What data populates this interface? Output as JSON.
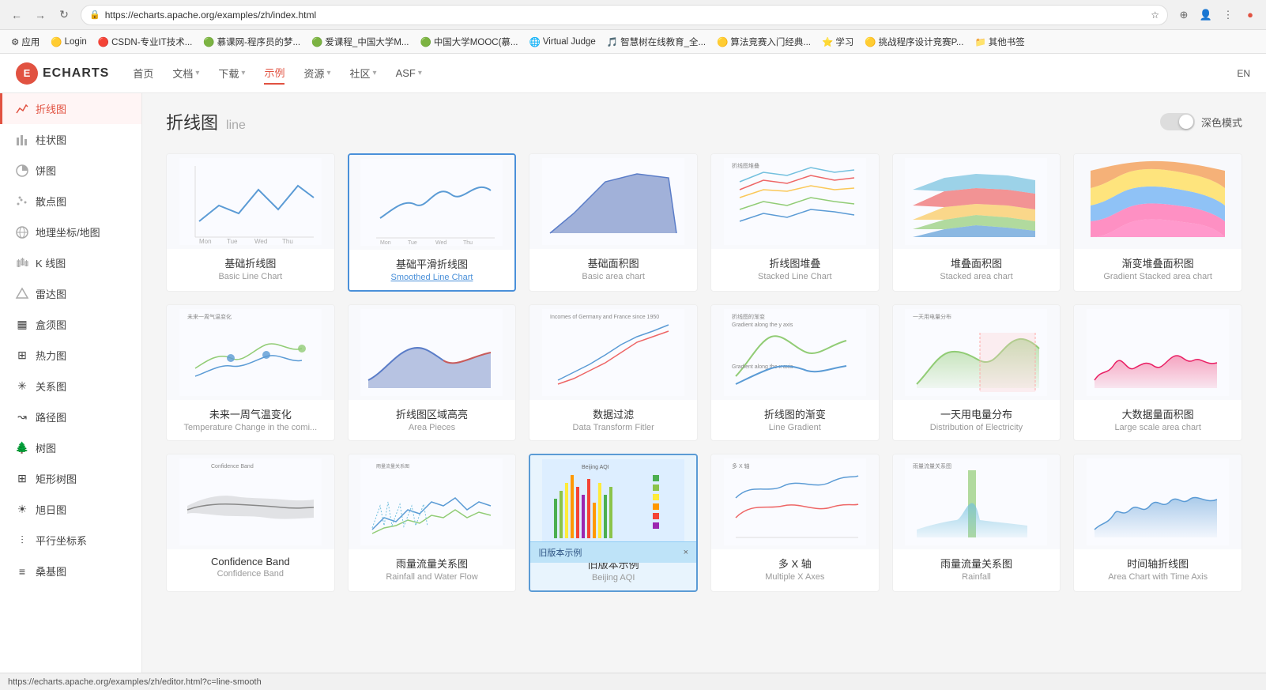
{
  "browser": {
    "url": "https://echarts.apache.org/examples/zh/index.html",
    "bookmarks": [
      {
        "label": "应用",
        "icon": "⚙"
      },
      {
        "label": "Login",
        "icon": "🟡"
      },
      {
        "label": "CSDN-专业IT技术...",
        "icon": "🔴"
      },
      {
        "label": "慕课网-程序员的梦...",
        "icon": "🟢"
      },
      {
        "label": "爱课程_中国大学M...",
        "icon": "🟢"
      },
      {
        "label": "中国大学MOOC(慕...",
        "icon": "🟢"
      },
      {
        "label": "Virtual Judge",
        "icon": "🌐"
      },
      {
        "label": "智慧树在线教育_全...",
        "icon": "🎵"
      },
      {
        "label": "算法竞赛入门经典...",
        "icon": "🟡"
      },
      {
        "label": "学习",
        "icon": "⭐"
      },
      {
        "label": "挑战程序设计竞赛P...",
        "icon": "🟡"
      },
      {
        "label": "其他书签",
        "icon": "📁"
      }
    ]
  },
  "header": {
    "logo": "ECHARTS",
    "nav": [
      {
        "label": "首页",
        "active": false
      },
      {
        "label": "文档",
        "active": false,
        "dropdown": true
      },
      {
        "label": "下载",
        "active": false,
        "dropdown": true
      },
      {
        "label": "示例",
        "active": true
      },
      {
        "label": "资源",
        "active": false,
        "dropdown": true
      },
      {
        "label": "社区",
        "active": false,
        "dropdown": true
      },
      {
        "label": "ASF",
        "active": false,
        "dropdown": true
      }
    ],
    "lang": "EN"
  },
  "sidebar": {
    "items": [
      {
        "label": "折线图",
        "icon": "📈",
        "active": true
      },
      {
        "label": "柱状图",
        "icon": "📊"
      },
      {
        "label": "饼图",
        "icon": "🥧"
      },
      {
        "label": "散点图",
        "icon": "📉"
      },
      {
        "label": "地理坐标/地图",
        "icon": "🗺"
      },
      {
        "label": "K 线图",
        "icon": "📊"
      },
      {
        "label": "雷达图",
        "icon": "⬡"
      },
      {
        "label": "盒须图",
        "icon": "▦"
      },
      {
        "label": "热力图",
        "icon": "⊞"
      },
      {
        "label": "关系图",
        "icon": "✳"
      },
      {
        "label": "路径图",
        "icon": "↝"
      },
      {
        "label": "树图",
        "icon": "🌲"
      },
      {
        "label": "矩形树图",
        "icon": "⊞"
      },
      {
        "label": "旭日图",
        "icon": "☀"
      },
      {
        "label": "平行坐标系",
        "icon": "⫶"
      },
      {
        "label": "桑基图",
        "icon": "≡"
      }
    ]
  },
  "page": {
    "title": "折线图",
    "subtitle": "line",
    "dark_mode_label": "深色模式",
    "charts_row1": [
      {
        "cn": "基础折线图",
        "en": "Basic Line Chart",
        "type": "basic-line"
      },
      {
        "cn": "基础平滑折线图",
        "en": "Smoothed Line Chart",
        "type": "smooth-line",
        "highlighted": true
      },
      {
        "cn": "基础面积图",
        "en": "Basic area chart",
        "type": "area"
      },
      {
        "cn": "折线图堆叠",
        "en": "Stacked Line Chart",
        "type": "stacked-line"
      },
      {
        "cn": "堆叠面积图",
        "en": "Stacked area chart",
        "type": "stacked-area"
      },
      {
        "cn": "渐变堆叠面积图",
        "en": "Gradient Stacked area chart",
        "type": "gradient-area"
      }
    ],
    "charts_row2": [
      {
        "cn": "未来一周气温变化",
        "en": "Temperature Change in the comi...",
        "type": "temp-change"
      },
      {
        "cn": "折线图区域高亮",
        "en": "Area Pieces",
        "type": "area-pieces"
      },
      {
        "cn": "数据过滤",
        "en": "Data Transform Fitler",
        "type": "data-filter"
      },
      {
        "cn": "折线图的渐变",
        "en": "Line Gradient",
        "type": "line-gradient"
      },
      {
        "cn": "一天用电量分布",
        "en": "Distribution of Electricity",
        "type": "electricity"
      },
      {
        "cn": "大数据量面积图",
        "en": "Large scale area chart",
        "type": "large-area"
      }
    ],
    "charts_row3": [
      {
        "cn": "Confidence Band",
        "en": "Confidence Band",
        "type": "confidence"
      },
      {
        "cn": "雨量流量关系图",
        "en": "Rainfall and Water Flow",
        "type": "rainfall-flow"
      },
      {
        "cn": "旧版本示例",
        "en": "Beijing AQI",
        "type": "beijing-aqi",
        "popup": true
      },
      {
        "cn": "多 X 轴",
        "en": "Multiple X Axes",
        "type": "multi-x"
      },
      {
        "cn": "雨量流量关系图",
        "en": "Rainfall",
        "type": "rainfall2"
      },
      {
        "cn": "时间轴折线图",
        "en": "Area Chart with Time Axis",
        "type": "time-axis"
      }
    ],
    "popup": {
      "text": "旧版本示例",
      "close": "×"
    }
  },
  "status_bar": {
    "url": "https://echarts.apache.org/examples/zh/editor.html?c=line-smooth"
  }
}
